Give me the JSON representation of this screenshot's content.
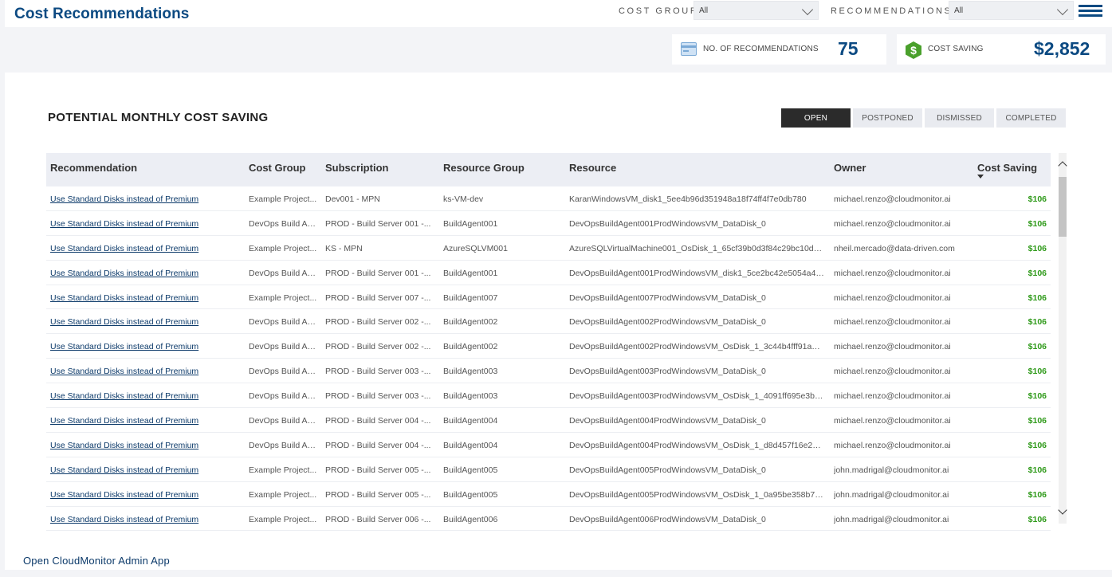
{
  "header": {
    "title": "Cost Recommendations",
    "cost_group_label": "COST GROUP",
    "cost_group_value": "All",
    "recommendations_label": "RECOMMENDATIONS",
    "recommendations_value": "All",
    "menu_icon": "hamburger-menu-icon"
  },
  "kpis": {
    "recommendations": {
      "icon": "card-icon",
      "label": "NO. OF RECOMMENDATIONS",
      "value": "75"
    },
    "cost_saving": {
      "icon": "dollar-hexagon-icon",
      "label": "COST SAVING",
      "value": "$2,852"
    }
  },
  "panel": {
    "title": "POTENTIAL MONTHLY COST SAVING",
    "tabs": [
      "OPEN",
      "POSTPONED",
      "DISMISSED",
      "COMPLETED"
    ],
    "active_tab": "OPEN"
  },
  "table": {
    "columns": [
      "Recommendation",
      "Cost Group",
      "Subscription",
      "Resource Group",
      "Resource",
      "Owner",
      "Cost Saving"
    ],
    "rows": [
      [
        "Use Standard Disks instead of Premium",
        "Example Project...",
        "Dev001 - MPN",
        "ks-VM-dev",
        "KaranWindowsVM_disk1_5ee4b96d351948a18f74ff4f7e0db780",
        "michael.renzo@cloudmonitor.ai",
        "$106"
      ],
      [
        "Use Standard Disks instead of Premium",
        "DevOps Build Ag...",
        "PROD - Build Server 001 -...",
        "BuildAgent001",
        "DevOpsBuildAgent001ProdWindowsVM_DataDisk_0",
        "michael.renzo@cloudmonitor.ai",
        "$106"
      ],
      [
        "Use Standard Disks instead of Premium",
        "Example Project...",
        "KS - MPN",
        "AzureSQLVM001",
        "AzureSQLVirtualMachine001_OsDisk_1_65cf39b0d3f84c29bc10d0...",
        "nheil.mercado@data-driven.com",
        "$106"
      ],
      [
        "Use Standard Disks instead of Premium",
        "DevOps Build Ag...",
        "PROD - Build Server 001 -...",
        "BuildAgent001",
        "DevOpsBuildAgent001ProdWindowsVM_disk1_5ce2bc42e5054a48...",
        "michael.renzo@cloudmonitor.ai",
        "$106"
      ],
      [
        "Use Standard Disks instead of Premium",
        "Example Project...",
        "PROD - Build Server 007 -...",
        "BuildAgent007",
        "DevOpsBuildAgent007ProdWindowsVM_DataDisk_0",
        "michael.renzo@cloudmonitor.ai",
        "$106"
      ],
      [
        "Use Standard Disks instead of Premium",
        "DevOps Build Ag...",
        "PROD - Build Server 002 -...",
        "BuildAgent002",
        "DevOpsBuildAgent002ProdWindowsVM_DataDisk_0",
        "michael.renzo@cloudmonitor.ai",
        "$106"
      ],
      [
        "Use Standard Disks instead of Premium",
        "DevOps Build Ag...",
        "PROD - Build Server 002 -...",
        "BuildAgent002",
        "DevOpsBuildAgent002ProdWindowsVM_OsDisk_1_3c44b4fff91a4d...",
        "michael.renzo@cloudmonitor.ai",
        "$106"
      ],
      [
        "Use Standard Disks instead of Premium",
        "DevOps Build Ag...",
        "PROD - Build Server 003 -...",
        "BuildAgent003",
        "DevOpsBuildAgent003ProdWindowsVM_DataDisk_0",
        "michael.renzo@cloudmonitor.ai",
        "$106"
      ],
      [
        "Use Standard Disks instead of Premium",
        "DevOps Build Ag...",
        "PROD - Build Server 003 -...",
        "BuildAgent003",
        "DevOpsBuildAgent003ProdWindowsVM_OsDisk_1_4091ff695e3b4...",
        "michael.renzo@cloudmonitor.ai",
        "$106"
      ],
      [
        "Use Standard Disks instead of Premium",
        "DevOps Build Ag...",
        "PROD - Build Server 004 -...",
        "BuildAgent004",
        "DevOpsBuildAgent004ProdWindowsVM_DataDisk_0",
        "michael.renzo@cloudmonitor.ai",
        "$106"
      ],
      [
        "Use Standard Disks instead of Premium",
        "DevOps Build Ag...",
        "PROD - Build Server 004 -...",
        "BuildAgent004",
        "DevOpsBuildAgent004ProdWindowsVM_OsDisk_1_d8d457f16e2a4...",
        "michael.renzo@cloudmonitor.ai",
        "$106"
      ],
      [
        "Use Standard Disks instead of Premium",
        "Example Project...",
        "PROD - Build Server 005 -...",
        "BuildAgent005",
        "DevOpsBuildAgent005ProdWindowsVM_DataDisk_0",
        "john.madrigal@cloudmonitor.ai",
        "$106"
      ],
      [
        "Use Standard Disks instead of Premium",
        "Example Project...",
        "PROD - Build Server 005 -...",
        "BuildAgent005",
        "DevOpsBuildAgent005ProdWindowsVM_OsDisk_1_0a95be358b74...",
        "john.madrigal@cloudmonitor.ai",
        "$106"
      ],
      [
        "Use Standard Disks instead of Premium",
        "Example Project...",
        "PROD - Build Server 006 -...",
        "BuildAgent006",
        "DevOpsBuildAgent006ProdWindowsVM_DataDisk_0",
        "john.madrigal@cloudmonitor.ai",
        "$106"
      ]
    ]
  },
  "footer": {
    "admin_link": "Open CloudMonitor Admin App"
  },
  "colors": {
    "brand": "#0c4a82",
    "saving_green": "#2f9a1a",
    "active_tab": "#2b2b2b"
  }
}
